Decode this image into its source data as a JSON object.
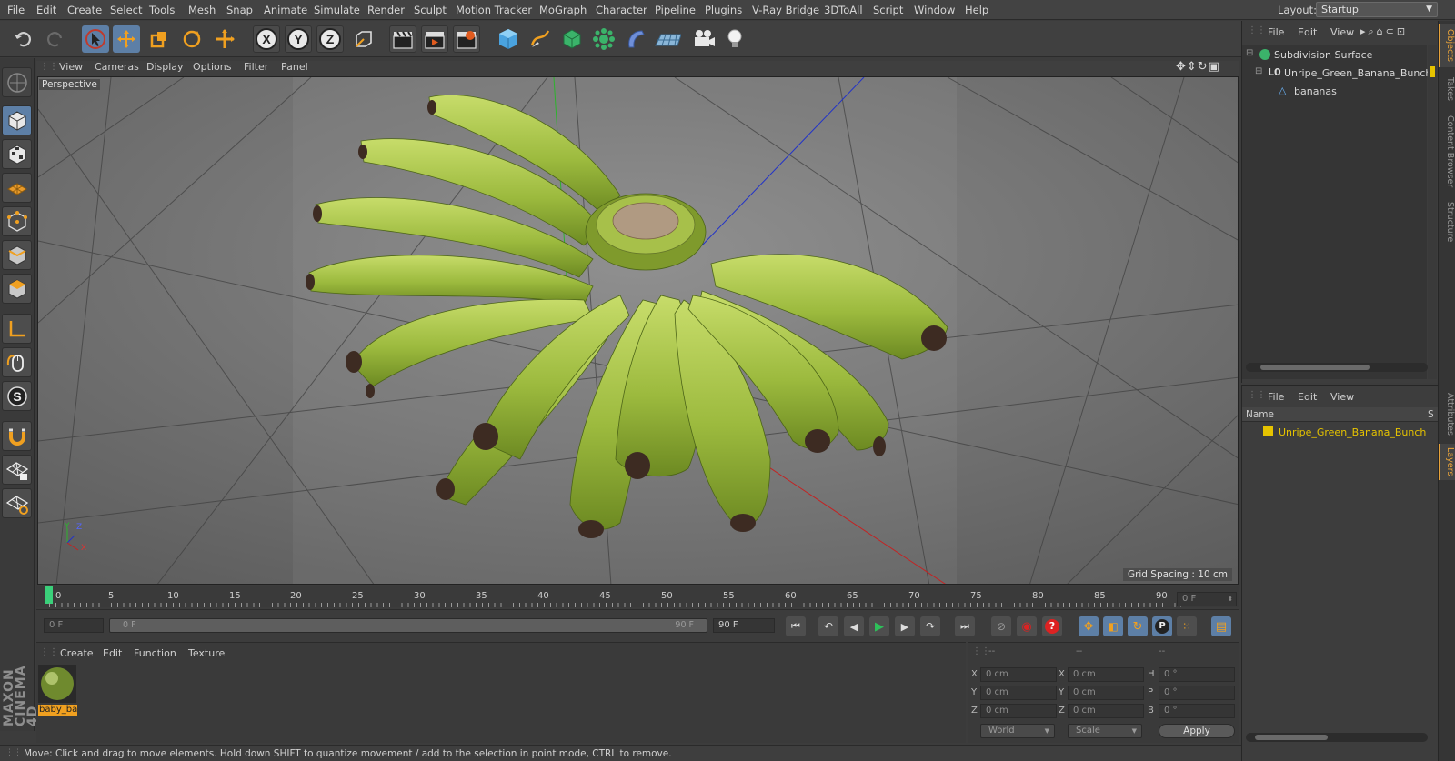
{
  "menubar": {
    "items": [
      "File",
      "Edit",
      "Create",
      "Select",
      "Tools",
      "Mesh",
      "Snap",
      "Animate",
      "Simulate",
      "Render",
      "Sculpt",
      "Motion Tracker",
      "MoGraph",
      "Character",
      "Pipeline",
      "Plugins",
      "V-Ray Bridge",
      "3DToAll",
      "Script",
      "Window",
      "Help"
    ],
    "layout_label": "Layout:",
    "layout_value": "Startup"
  },
  "viewport": {
    "menu": [
      "View",
      "Cameras",
      "Display",
      "Options",
      "Filter",
      "Panel"
    ],
    "label": "Perspective",
    "grid_spacing": "Grid Spacing : 10 cm",
    "axis_labels": {
      "y": "Y",
      "z": "Z",
      "x": "X"
    }
  },
  "objects_panel": {
    "menu": [
      "File",
      "Edit",
      "View"
    ],
    "items": [
      {
        "name": "Subdivision Surface"
      },
      {
        "name": "Unripe_Green_Banana_Bunch"
      },
      {
        "name": "bananas"
      }
    ],
    "side_tabs": [
      "Objects",
      "Takes",
      "Content Browser",
      "Structure"
    ]
  },
  "layers_panel": {
    "menu": [
      "File",
      "Edit",
      "View"
    ],
    "header_name": "Name",
    "header_s": "S",
    "items": [
      {
        "name": "Unripe_Green_Banana_Bunch",
        "color": "#e6c300"
      }
    ],
    "side_tabs": [
      "Attributes",
      "Layers"
    ]
  },
  "timeline": {
    "ticks": [
      "0",
      "5",
      "10",
      "15",
      "20",
      "25",
      "30",
      "35",
      "40",
      "45",
      "50",
      "55",
      "60",
      "65",
      "70",
      "75",
      "80",
      "85",
      "90"
    ],
    "current_frame": "0 F",
    "start_field": "0 F",
    "slider_start": "0 F",
    "slider_end": "90 F",
    "end_field": "90 F"
  },
  "material_manager": {
    "menu": [
      "Create",
      "Edit",
      "Function",
      "Texture"
    ],
    "material_name": "baby_ba"
  },
  "coordinates": {
    "headers": [
      "--",
      "--",
      "--"
    ],
    "rows": [
      {
        "a": "X",
        "av": "0 cm",
        "b": "X",
        "bv": "0 cm",
        "c": "H",
        "cv": "0 °"
      },
      {
        "a": "Y",
        "av": "0 cm",
        "b": "Y",
        "bv": "0 cm",
        "c": "P",
        "cv": "0 °"
      },
      {
        "a": "Z",
        "av": "0 cm",
        "b": "Z",
        "bv": "0 cm",
        "c": "B",
        "cv": "0 °"
      }
    ],
    "mode1": "World",
    "mode2": "Scale",
    "apply": "Apply"
  },
  "statusbar": {
    "text": "Move: Click and drag to move elements. Hold down SHIFT to quantize movement / add to the selection in point mode, CTRL to remove."
  },
  "branding": {
    "text": "MAXON CINEMA 4D"
  },
  "colors": {
    "accent": "#5d7fa6",
    "highlight_orange": "#e8a33a",
    "layer_yellow": "#e6c300",
    "banana_green": "#9cba3e"
  }
}
